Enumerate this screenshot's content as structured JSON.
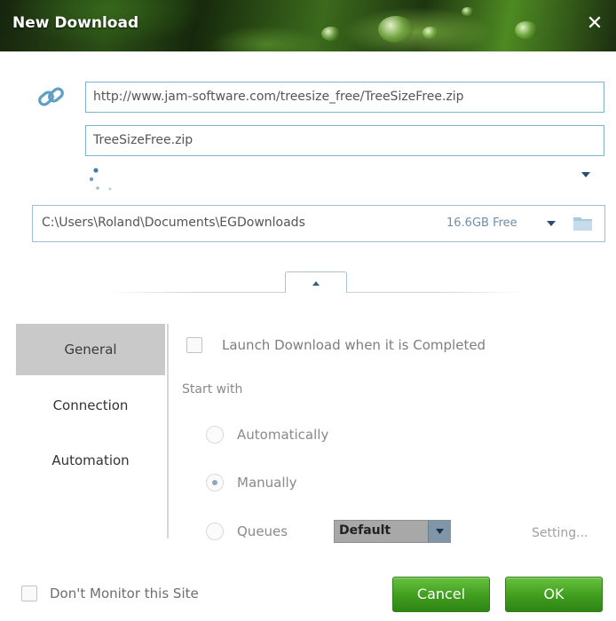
{
  "window": {
    "title": "New Download",
    "close_glyph": "✕"
  },
  "url_section": {
    "url": "http://www.jam-software.com/treesize_free/TreeSizeFree.zip",
    "filename": "TreeSizeFree.zip",
    "icons": [
      "link-icon",
      "loading-dots-icon",
      "expand-arrow-icon"
    ]
  },
  "save_location": {
    "path": "C:\\Users\\Roland\\Documents\\EGDownloads",
    "free_space": "16.6GB Free",
    "icons": [
      "dropdown-arrow-icon",
      "folder-icon"
    ]
  },
  "collapse_tab": {
    "icon": "chevron-up-icon"
  },
  "nav": {
    "items": [
      {
        "label": "General",
        "active": true
      },
      {
        "label": "Connection",
        "active": false
      },
      {
        "label": "Automation",
        "active": false
      }
    ]
  },
  "general": {
    "launch_when_completed": {
      "label": "Launch Download when it is Completed",
      "checked": false
    },
    "start_with_label": "Start with",
    "options": [
      {
        "label": "Automatically",
        "selected": false
      },
      {
        "label": "Manually",
        "selected": true
      },
      {
        "label": "Queues",
        "selected": false
      }
    ],
    "queue_value": "Default",
    "settings_link": "Setting..."
  },
  "footer": {
    "dont_monitor": {
      "label": "Don't Monitor this Site",
      "checked": false
    },
    "cancel_label": "Cancel",
    "ok_label": "OK"
  },
  "colors": {
    "field_border": "#7fb3cc",
    "nav_active": "#c9c9c9",
    "button_green": "#3f9d1e"
  }
}
